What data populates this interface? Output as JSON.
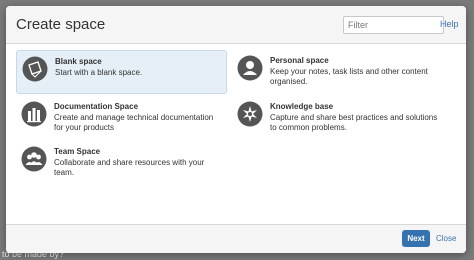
{
  "background": {
    "text": "to be made by?"
  },
  "dialog": {
    "title": "Create space",
    "filter": {
      "placeholder": "Filter",
      "value": ""
    },
    "help_label": "Help",
    "templates": [
      {
        "name": "Blank space",
        "description": "Start with a blank space.",
        "icon": "blank-space-icon",
        "selected": true
      },
      {
        "name": "Personal space",
        "description": "Keep your notes, task lists and other content organised.",
        "icon": "personal-space-icon",
        "selected": false
      },
      {
        "name": "Documentation Space",
        "description": "Create and manage technical documentation for your products",
        "icon": "documentation-space-icon",
        "selected": false
      },
      {
        "name": "Knowledge base",
        "description": "Capture and share best practices and solutions to common problems.",
        "icon": "knowledge-base-icon",
        "selected": false
      },
      {
        "name": "Team Space",
        "description": "Collaborate and share resources with your team.",
        "icon": "team-space-icon",
        "selected": false
      }
    ],
    "footer": {
      "next_label": "Next",
      "close_label": "Close"
    }
  },
  "colors": {
    "accent": "#3572b0",
    "link": "#3b73af",
    "selected_tile": "#e6eff8",
    "icon_dark": "#555555"
  }
}
